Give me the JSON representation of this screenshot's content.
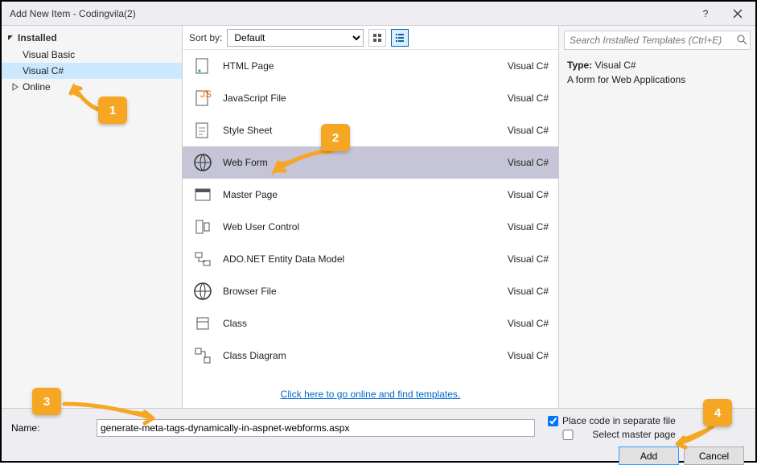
{
  "window": {
    "title": "Add New Item - Codingvila(2)"
  },
  "sidebar": {
    "installed_label": "Installed",
    "items": [
      {
        "label": "Visual Basic"
      },
      {
        "label": "Visual C#"
      }
    ],
    "online_label": "Online"
  },
  "sortbar": {
    "label": "Sort by:",
    "selected": "Default"
  },
  "templates": [
    {
      "label": "HTML Page",
      "lang": "Visual C#"
    },
    {
      "label": "JavaScript File",
      "lang": "Visual C#"
    },
    {
      "label": "Style Sheet",
      "lang": "Visual C#"
    },
    {
      "label": "Web Form",
      "lang": "Visual C#"
    },
    {
      "label": "Master Page",
      "lang": "Visual C#"
    },
    {
      "label": "Web User Control",
      "lang": "Visual C#"
    },
    {
      "label": "ADO.NET Entity Data Model",
      "lang": "Visual C#"
    },
    {
      "label": "Browser File",
      "lang": "Visual C#"
    },
    {
      "label": "Class",
      "lang": "Visual C#"
    },
    {
      "label": "Class Diagram",
      "lang": "Visual C#"
    }
  ],
  "online_link": "Click here to go online and find templates.",
  "search": {
    "placeholder": "Search Installed Templates (Ctrl+E)"
  },
  "details": {
    "type_label": "Type:",
    "type_value": "Visual C#",
    "description": "A form for Web Applications"
  },
  "bottom": {
    "name_label": "Name:",
    "name_value": "generate-meta-tags-dynamically-in-aspnet-webforms.aspx",
    "cb1": "Place code in separate file",
    "cb2": "Select master page",
    "add": "Add",
    "cancel": "Cancel"
  },
  "callouts": {
    "c1": "1",
    "c2": "2",
    "c3": "3",
    "c4": "4"
  }
}
